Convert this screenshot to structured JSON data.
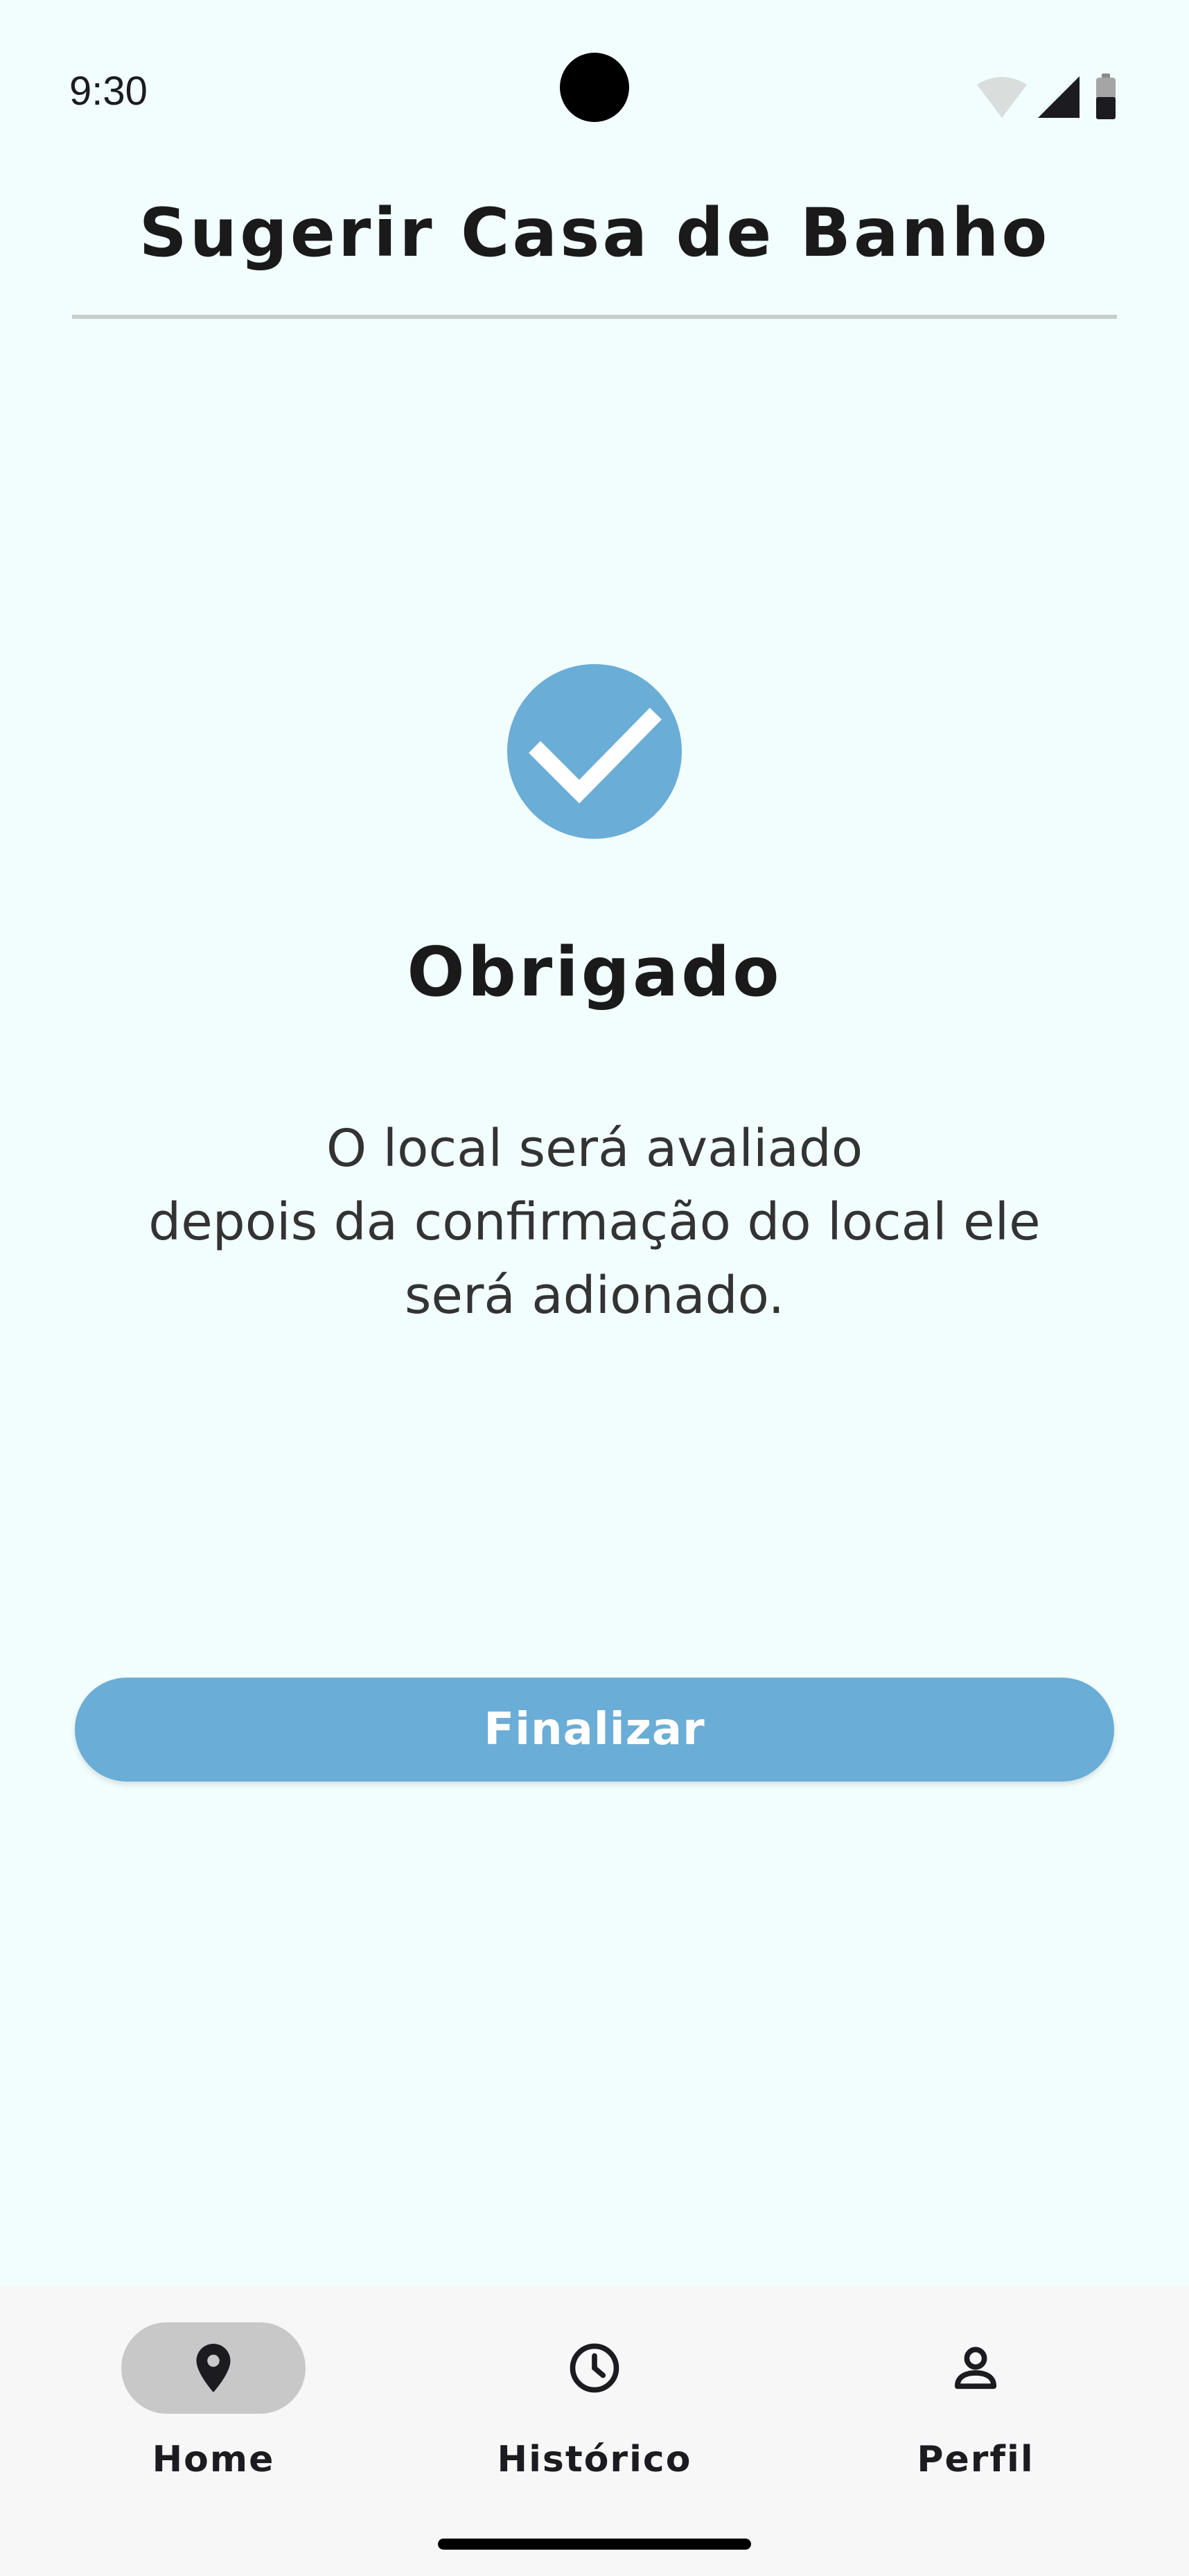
{
  "status_bar": {
    "time": "9:30",
    "icons": [
      "wifi-icon",
      "cellular-signal-icon",
      "battery-icon"
    ]
  },
  "header": {
    "title": "Sugerir Casa de Banho"
  },
  "confirmation": {
    "icon": "check-circle-icon",
    "title": "Obrigado",
    "message_lines": [
      "O local será avaliado",
      "depois da confirmação do local ele",
      "será adionado."
    ]
  },
  "actions": {
    "finish_label": "Finalizar"
  },
  "bottom_nav": {
    "items": [
      {
        "label": "Home",
        "icon": "location-pin-icon",
        "active": true
      },
      {
        "label": "Histórico",
        "icon": "clock-icon",
        "active": false
      },
      {
        "label": "Perfil",
        "icon": "person-icon",
        "active": false
      }
    ]
  },
  "colors": {
    "background": "#f2fefd",
    "accent": "#6aadd6",
    "nav_background": "#f7f7f7",
    "active_pill": "#c8c8c8"
  }
}
